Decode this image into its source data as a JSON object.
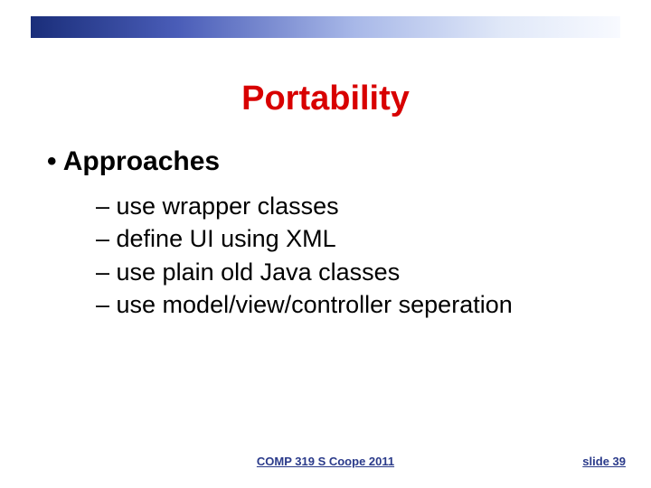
{
  "title": "Portability",
  "main_bullet": "• Approaches",
  "sub_items": [
    "– use wrapper classes",
    "– define UI using XML",
    "– use plain old Java classes",
    "– use model/view/controller seperation"
  ],
  "footer_course": "COMP 319 S Coope 2011",
  "footer_slide": "slide 39"
}
